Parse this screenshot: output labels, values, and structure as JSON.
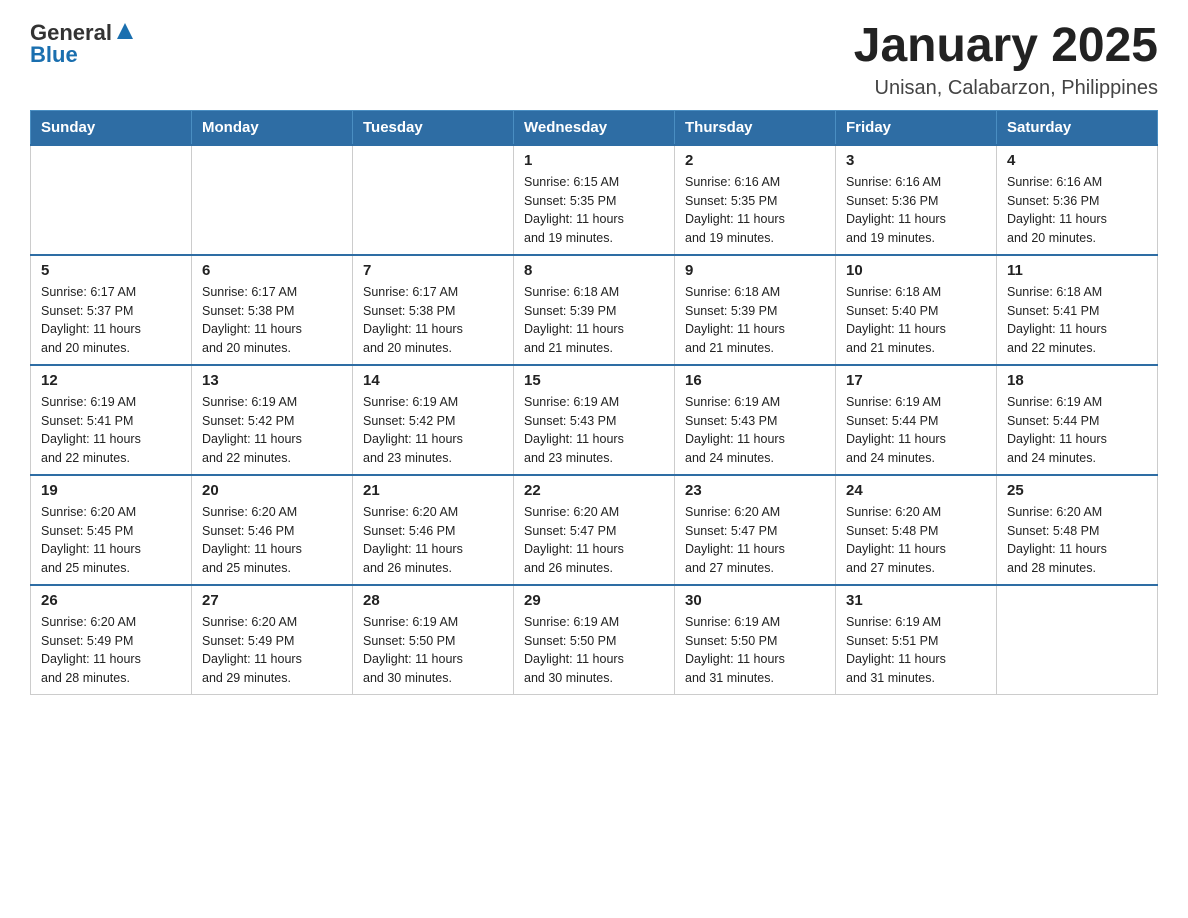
{
  "header": {
    "logo": {
      "general": "General",
      "blue": "Blue"
    },
    "title": "January 2025",
    "subtitle": "Unisan, Calabarzon, Philippines"
  },
  "days_of_week": [
    "Sunday",
    "Monday",
    "Tuesday",
    "Wednesday",
    "Thursday",
    "Friday",
    "Saturday"
  ],
  "weeks": [
    [
      {
        "day": "",
        "info": ""
      },
      {
        "day": "",
        "info": ""
      },
      {
        "day": "",
        "info": ""
      },
      {
        "day": "1",
        "info": "Sunrise: 6:15 AM\nSunset: 5:35 PM\nDaylight: 11 hours\nand 19 minutes."
      },
      {
        "day": "2",
        "info": "Sunrise: 6:16 AM\nSunset: 5:35 PM\nDaylight: 11 hours\nand 19 minutes."
      },
      {
        "day": "3",
        "info": "Sunrise: 6:16 AM\nSunset: 5:36 PM\nDaylight: 11 hours\nand 19 minutes."
      },
      {
        "day": "4",
        "info": "Sunrise: 6:16 AM\nSunset: 5:36 PM\nDaylight: 11 hours\nand 20 minutes."
      }
    ],
    [
      {
        "day": "5",
        "info": "Sunrise: 6:17 AM\nSunset: 5:37 PM\nDaylight: 11 hours\nand 20 minutes."
      },
      {
        "day": "6",
        "info": "Sunrise: 6:17 AM\nSunset: 5:38 PM\nDaylight: 11 hours\nand 20 minutes."
      },
      {
        "day": "7",
        "info": "Sunrise: 6:17 AM\nSunset: 5:38 PM\nDaylight: 11 hours\nand 20 minutes."
      },
      {
        "day": "8",
        "info": "Sunrise: 6:18 AM\nSunset: 5:39 PM\nDaylight: 11 hours\nand 21 minutes."
      },
      {
        "day": "9",
        "info": "Sunrise: 6:18 AM\nSunset: 5:39 PM\nDaylight: 11 hours\nand 21 minutes."
      },
      {
        "day": "10",
        "info": "Sunrise: 6:18 AM\nSunset: 5:40 PM\nDaylight: 11 hours\nand 21 minutes."
      },
      {
        "day": "11",
        "info": "Sunrise: 6:18 AM\nSunset: 5:41 PM\nDaylight: 11 hours\nand 22 minutes."
      }
    ],
    [
      {
        "day": "12",
        "info": "Sunrise: 6:19 AM\nSunset: 5:41 PM\nDaylight: 11 hours\nand 22 minutes."
      },
      {
        "day": "13",
        "info": "Sunrise: 6:19 AM\nSunset: 5:42 PM\nDaylight: 11 hours\nand 22 minutes."
      },
      {
        "day": "14",
        "info": "Sunrise: 6:19 AM\nSunset: 5:42 PM\nDaylight: 11 hours\nand 23 minutes."
      },
      {
        "day": "15",
        "info": "Sunrise: 6:19 AM\nSunset: 5:43 PM\nDaylight: 11 hours\nand 23 minutes."
      },
      {
        "day": "16",
        "info": "Sunrise: 6:19 AM\nSunset: 5:43 PM\nDaylight: 11 hours\nand 24 minutes."
      },
      {
        "day": "17",
        "info": "Sunrise: 6:19 AM\nSunset: 5:44 PM\nDaylight: 11 hours\nand 24 minutes."
      },
      {
        "day": "18",
        "info": "Sunrise: 6:19 AM\nSunset: 5:44 PM\nDaylight: 11 hours\nand 24 minutes."
      }
    ],
    [
      {
        "day": "19",
        "info": "Sunrise: 6:20 AM\nSunset: 5:45 PM\nDaylight: 11 hours\nand 25 minutes."
      },
      {
        "day": "20",
        "info": "Sunrise: 6:20 AM\nSunset: 5:46 PM\nDaylight: 11 hours\nand 25 minutes."
      },
      {
        "day": "21",
        "info": "Sunrise: 6:20 AM\nSunset: 5:46 PM\nDaylight: 11 hours\nand 26 minutes."
      },
      {
        "day": "22",
        "info": "Sunrise: 6:20 AM\nSunset: 5:47 PM\nDaylight: 11 hours\nand 26 minutes."
      },
      {
        "day": "23",
        "info": "Sunrise: 6:20 AM\nSunset: 5:47 PM\nDaylight: 11 hours\nand 27 minutes."
      },
      {
        "day": "24",
        "info": "Sunrise: 6:20 AM\nSunset: 5:48 PM\nDaylight: 11 hours\nand 27 minutes."
      },
      {
        "day": "25",
        "info": "Sunrise: 6:20 AM\nSunset: 5:48 PM\nDaylight: 11 hours\nand 28 minutes."
      }
    ],
    [
      {
        "day": "26",
        "info": "Sunrise: 6:20 AM\nSunset: 5:49 PM\nDaylight: 11 hours\nand 28 minutes."
      },
      {
        "day": "27",
        "info": "Sunrise: 6:20 AM\nSunset: 5:49 PM\nDaylight: 11 hours\nand 29 minutes."
      },
      {
        "day": "28",
        "info": "Sunrise: 6:19 AM\nSunset: 5:50 PM\nDaylight: 11 hours\nand 30 minutes."
      },
      {
        "day": "29",
        "info": "Sunrise: 6:19 AM\nSunset: 5:50 PM\nDaylight: 11 hours\nand 30 minutes."
      },
      {
        "day": "30",
        "info": "Sunrise: 6:19 AM\nSunset: 5:50 PM\nDaylight: 11 hours\nand 31 minutes."
      },
      {
        "day": "31",
        "info": "Sunrise: 6:19 AM\nSunset: 5:51 PM\nDaylight: 11 hours\nand 31 minutes."
      },
      {
        "day": "",
        "info": ""
      }
    ]
  ]
}
